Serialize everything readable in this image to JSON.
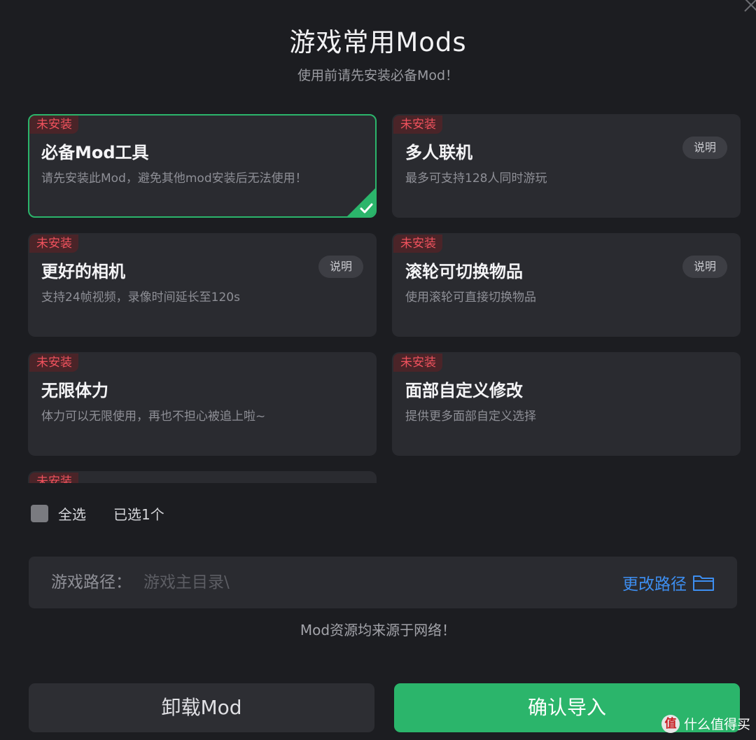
{
  "header": {
    "title": "游戏常用Mods",
    "subtitle": "使用前请先安装必备Mod！"
  },
  "mods": [
    {
      "badge": "未安装",
      "title": "必备Mod工具",
      "desc": "请先安装此Mod，避免其他mod安装后无法使用！",
      "info": null,
      "selected": true
    },
    {
      "badge": "未安装",
      "title": "多人联机",
      "desc": "最多可支持128人同时游玩",
      "info": "说明",
      "selected": false
    },
    {
      "badge": "未安装",
      "title": "更好的相机",
      "desc": "支持24帧视频，录像时间延长至120s",
      "info": "说明",
      "selected": false
    },
    {
      "badge": "未安装",
      "title": "滚轮可切换物品",
      "desc": "使用滚轮可直接切换物品",
      "info": "说明",
      "selected": false
    },
    {
      "badge": "未安装",
      "title": "无限体力",
      "desc": "体力可以无限使用，再也不担心被追上啦~",
      "info": null,
      "selected": false
    },
    {
      "badge": "未安装",
      "title": "面部自定义修改",
      "desc": "提供更多面部自定义选择",
      "info": null,
      "selected": false
    },
    {
      "badge": "未安装",
      "title": "",
      "desc": "",
      "info": null,
      "selected": false
    }
  ],
  "selection": {
    "select_all_label": "全选",
    "selected_count": "已选1个"
  },
  "path": {
    "label": "游戏路径：",
    "value": "游戏主目录\\",
    "change_label": "更改路径"
  },
  "footer_note": "Mod资源均来源于网络！",
  "buttons": {
    "uninstall": "卸载Mod",
    "confirm": "确认导入"
  },
  "watermark": {
    "logo": "值",
    "text": "什么值得买"
  },
  "colors": {
    "accent_green": "#2bb56b",
    "badge_red": "#f0525d",
    "link_blue": "#3d8ef0"
  }
}
